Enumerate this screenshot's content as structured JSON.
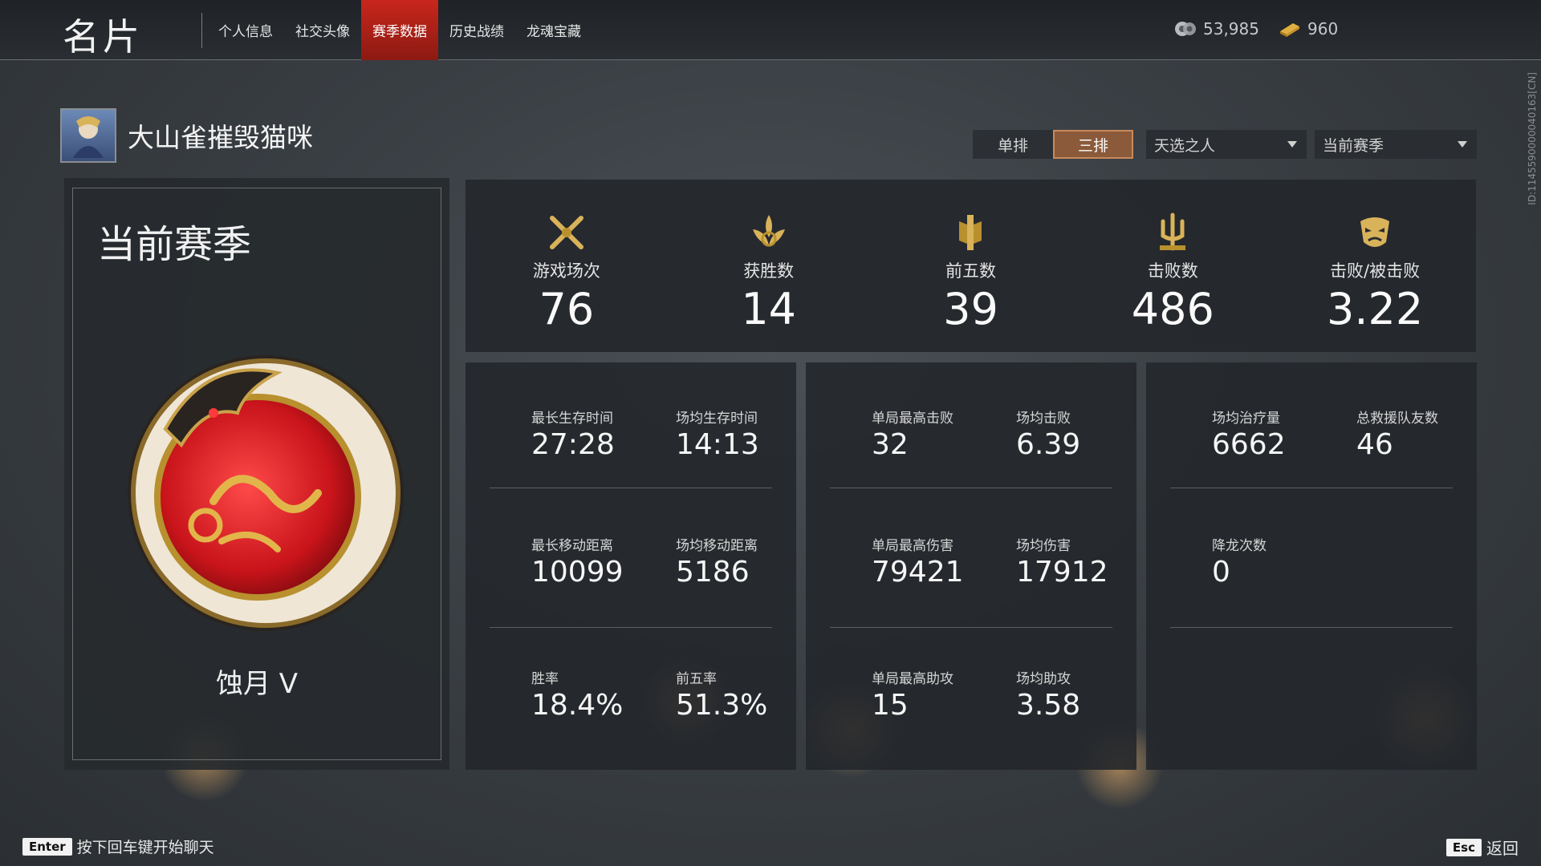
{
  "header": {
    "title": "名片",
    "tabs": [
      {
        "label": "个人信息"
      },
      {
        "label": "社交头像"
      },
      {
        "label": "赛季数据",
        "active": true
      },
      {
        "label": "历史战绩"
      },
      {
        "label": "龙魂宝藏"
      }
    ],
    "currency": [
      {
        "icon": "jade-coin-icon",
        "value": "53,985"
      },
      {
        "icon": "gold-ingot-icon",
        "value": "960"
      }
    ]
  },
  "side_id": "ID:1145590000040163[CN]",
  "profile": {
    "name": "大山雀摧毁猫咪"
  },
  "filters": {
    "modes": [
      {
        "label": "单排"
      },
      {
        "label": "三排",
        "active": true
      }
    ],
    "mode_select": "天选之人",
    "season_select": "当前赛季"
  },
  "season_card": {
    "title": "当前赛季",
    "rank": "蚀月 V"
  },
  "top_stats": [
    {
      "icon": "crossed-swords-icon",
      "label": "游戏场次",
      "value": "76"
    },
    {
      "icon": "lotus-flame-icon",
      "label": "获胜数",
      "value": "14"
    },
    {
      "icon": "pillar-banner-icon",
      "label": "前五数",
      "value": "39"
    },
    {
      "icon": "trident-icon",
      "label": "击败数",
      "value": "486"
    },
    {
      "icon": "demon-mask-icon",
      "label": "击败/被击败",
      "value": "3.22"
    }
  ],
  "panels": [
    {
      "cells": [
        {
          "label": "最长生存时间",
          "value": "27:28"
        },
        {
          "label": "场均生存时间",
          "value": "14:13"
        },
        {
          "label": "最长移动距离",
          "value": "10099"
        },
        {
          "label": "场均移动距离",
          "value": "5186"
        },
        {
          "label": "胜率",
          "value": "18.4%"
        },
        {
          "label": "前五率",
          "value": "51.3%"
        }
      ]
    },
    {
      "cells": [
        {
          "label": "单局最高击败",
          "value": "32"
        },
        {
          "label": "场均击败",
          "value": "6.39"
        },
        {
          "label": "单局最高伤害",
          "value": "79421"
        },
        {
          "label": "场均伤害",
          "value": "17912"
        },
        {
          "label": "单局最高助攻",
          "value": "15"
        },
        {
          "label": "场均助攻",
          "value": "3.58"
        }
      ]
    },
    {
      "cells": [
        {
          "label": "场均治疗量",
          "value": "6662"
        },
        {
          "label": "总救援队友数",
          "value": "46"
        },
        {
          "label": "降龙次数",
          "value": "0"
        }
      ]
    }
  ],
  "footer": {
    "enter_key": "Enter",
    "enter_hint": "按下回车键开始聊天",
    "esc_key": "Esc",
    "esc_hint": "返回"
  },
  "colors": {
    "accent_red": "#c8261c",
    "selected_brown": "#8a5a3a",
    "gold": "#c9a24a"
  }
}
